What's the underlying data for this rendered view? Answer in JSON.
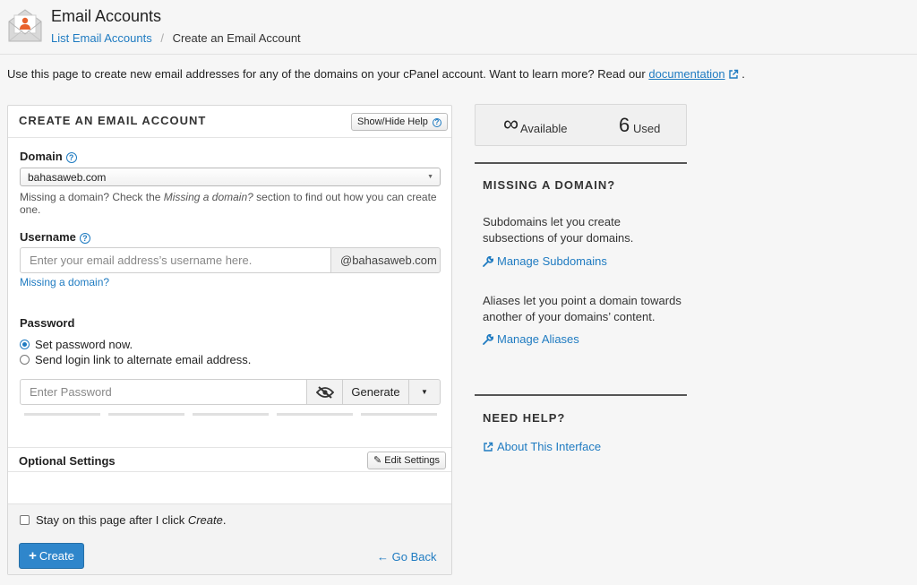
{
  "header": {
    "app_title": "Email Accounts",
    "breadcrumb": {
      "parent": "List Email Accounts",
      "separator": "/",
      "current": "Create an Email Account"
    }
  },
  "intro": {
    "text": "Use this page to create new email addresses for any of the domains on your cPanel account. Want to learn more? Read our",
    "link": "documentation",
    "suffix": "."
  },
  "form": {
    "title": "CREATE AN EMAIL ACCOUNT",
    "help_button": "Show/Hide Help",
    "domain": {
      "label": "Domain",
      "value": "bahasaweb.com",
      "hint_prefix": "Missing a domain? Check the ",
      "hint_em": "Missing a domain?",
      "hint_suffix": " section to find out how you can create one."
    },
    "username": {
      "label": "Username",
      "placeholder": "Enter your email address’s username here.",
      "suffix": "@bahasaweb.com",
      "missing_link": "Missing a domain?"
    },
    "password": {
      "label": "Password",
      "option_set_now": "Set password now.",
      "option_send_link": "Send login link to alternate email address.",
      "selected": "Set password now.",
      "placeholder": "Enter Password",
      "generate": "Generate"
    },
    "optional": {
      "title": "Optional Settings",
      "edit_button": "Edit Settings"
    },
    "stay_prefix": "Stay on this page after I click ",
    "stay_em": "Create",
    "stay_suffix": ".",
    "create_button": "Create",
    "go_back": "Go Back"
  },
  "stats": {
    "available_value": "∞",
    "available_label": "Available",
    "used_value": "6",
    "used_label": "Used"
  },
  "sidebar": {
    "missing_title": "MISSING A DOMAIN?",
    "subdomains_text": "Subdomains let you create subsections of your domains.",
    "subdomains_link": "Manage Subdomains",
    "aliases_text": "Aliases let you point a domain towards another of your domains’ content.",
    "aliases_link": "Manage Aliases",
    "help_title": "NEED HELP?",
    "about_link": "About This Interface"
  },
  "colors": {
    "link": "#1f7bc1",
    "primary_button": "#2f86cb",
    "icon_orange": "#e8612c"
  }
}
